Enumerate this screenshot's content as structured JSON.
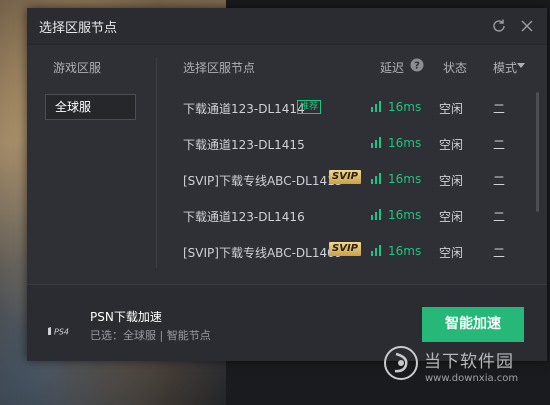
{
  "window": {
    "title": "选择区服节点"
  },
  "left_panel": {
    "label": "游戏区服",
    "selected_region": "全球服"
  },
  "columns": {
    "node": "选择区服节点",
    "latency": "延迟",
    "status": "状态",
    "mode": "模式"
  },
  "nodes": [
    {
      "name": "下载通道123-DL1414",
      "badge": "推荐",
      "latency": "16ms",
      "status": "空闲",
      "mode": "二"
    },
    {
      "name": "下载通道123-DL1415",
      "badge": "",
      "latency": "16ms",
      "status": "空闲",
      "mode": "二"
    },
    {
      "name": "[SVIP]下载专线ABC-DL1413",
      "badge": "SVIP",
      "latency": "16ms",
      "status": "空闲",
      "mode": "二"
    },
    {
      "name": "下载通道123-DL1416",
      "badge": "",
      "latency": "16ms",
      "status": "空闲",
      "mode": "二"
    },
    {
      "name": "[SVIP]下载专线ABC-DL1409",
      "badge": "SVIP",
      "latency": "16ms",
      "status": "空闲",
      "mode": "二"
    }
  ],
  "footer": {
    "platform_logo": "PS4",
    "title": "PSN下载加速",
    "selection": "已选：全球服 | 智能节点",
    "accelerate_button": "智能加速"
  },
  "watermark": {
    "text": "当下软件园",
    "url": "www.downxia.com"
  },
  "icons": {
    "refresh": "refresh-icon",
    "close": "close-icon",
    "help": "question-icon",
    "caret": "caret-down-icon",
    "signal": "signal-bars-icon"
  },
  "colors": {
    "accent_green": "#26b878",
    "latency_green": "#22c37c",
    "svip_gold": "#d9b45e",
    "dialog_bg": "#2e3036"
  }
}
